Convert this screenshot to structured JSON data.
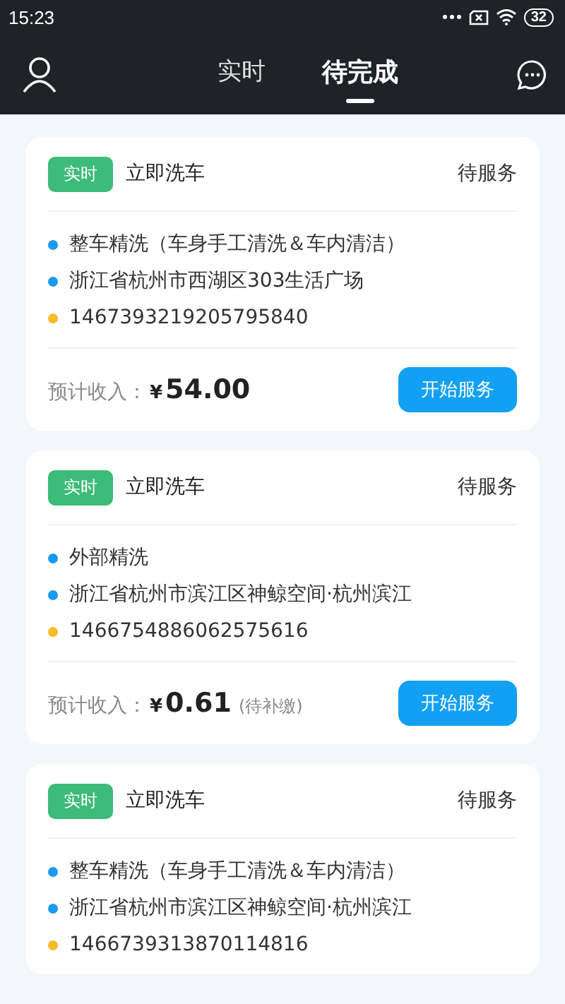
{
  "status_bar": {
    "time": "15:23",
    "battery": "32"
  },
  "header": {
    "tabs": [
      {
        "label": "实时",
        "selected": false
      },
      {
        "label": "待完成",
        "selected": true
      }
    ]
  },
  "orders": [
    {
      "tag": "实时",
      "title": "立即洗车",
      "status": "待服务",
      "items": [
        {
          "text": "整车精洗（车身手工清洗＆车内清洁）",
          "color": "#1a9af0"
        },
        {
          "text": "浙江省杭州市西湖区303生活广场",
          "color": "#1a9af0"
        },
        {
          "text": "1467393219205795840",
          "color": "#f5bd2a"
        }
      ],
      "footer": {
        "income_label": "预计收入：",
        "currency": "¥",
        "amount": "54.00",
        "button": "开始服务"
      }
    },
    {
      "tag": "实时",
      "title": "立即洗车",
      "status": "待服务",
      "items": [
        {
          "text": "外部精洗",
          "color": "#1a9af0"
        },
        {
          "text": "浙江省杭州市滨江区神鲸空间·杭州滨江",
          "color": "#1a9af0"
        },
        {
          "text": "1466754886062575616",
          "color": "#f5bd2a"
        }
      ],
      "footer": {
        "income_label": "预计收入：",
        "currency": "¥",
        "amount": "0.61",
        "note": "(待补缴)",
        "button": "开始服务"
      }
    },
    {
      "tag": "实时",
      "title": "立即洗车",
      "status": "待服务",
      "items": [
        {
          "text": "整车精洗（车身手工清洗＆车内清洁）",
          "color": "#1a9af0"
        },
        {
          "text": "浙江省杭州市滨江区神鲸空间·杭州滨江",
          "color": "#1a9af0"
        },
        {
          "text": "1466739313870114816",
          "color": "#f5bd2a"
        }
      ]
    }
  ]
}
